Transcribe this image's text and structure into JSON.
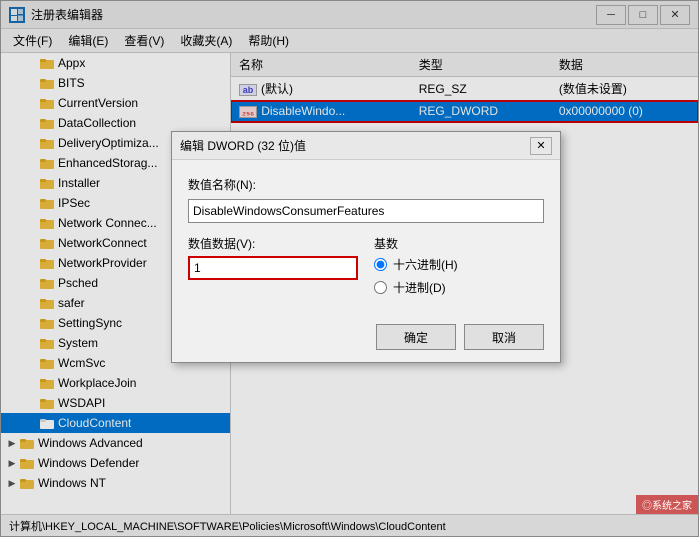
{
  "window": {
    "title": "注册表编辑器",
    "icon_text": "R"
  },
  "menu": {
    "items": [
      "文件(F)",
      "编辑(E)",
      "查看(V)",
      "收藏夹(A)",
      "帮助(H)"
    ]
  },
  "tree": {
    "items": [
      {
        "label": "Appx",
        "indent": 1,
        "expanded": false,
        "selected": false
      },
      {
        "label": "BITS",
        "indent": 1,
        "expanded": false,
        "selected": false
      },
      {
        "label": "CurrentVersion",
        "indent": 1,
        "expanded": false,
        "selected": false
      },
      {
        "label": "DataCollection",
        "indent": 1,
        "expanded": false,
        "selected": false
      },
      {
        "label": "DeliveryOptimiza...",
        "indent": 1,
        "expanded": false,
        "selected": false
      },
      {
        "label": "EnhancedStorag...",
        "indent": 1,
        "expanded": false,
        "selected": false
      },
      {
        "label": "Installer",
        "indent": 1,
        "expanded": false,
        "selected": false
      },
      {
        "label": "IPSec",
        "indent": 1,
        "expanded": false,
        "selected": false
      },
      {
        "label": "Network Connec...",
        "indent": 1,
        "expanded": false,
        "selected": false
      },
      {
        "label": "NetworkConnect",
        "indent": 1,
        "expanded": false,
        "selected": false
      },
      {
        "label": "NetworkProvider",
        "indent": 1,
        "expanded": false,
        "selected": false
      },
      {
        "label": "Psched",
        "indent": 1,
        "expanded": false,
        "selected": false
      },
      {
        "label": "safer",
        "indent": 1,
        "expanded": false,
        "selected": false
      },
      {
        "label": "SettingSync",
        "indent": 1,
        "expanded": false,
        "selected": false
      },
      {
        "label": "System",
        "indent": 1,
        "expanded": false,
        "selected": false
      },
      {
        "label": "WcmSvc",
        "indent": 1,
        "expanded": false,
        "selected": false
      },
      {
        "label": "WorkplaceJoin",
        "indent": 1,
        "expanded": false,
        "selected": false
      },
      {
        "label": "WSDAPI",
        "indent": 1,
        "expanded": false,
        "selected": false
      },
      {
        "label": "CloudContent",
        "indent": 1,
        "expanded": false,
        "selected": true
      },
      {
        "label": "Windows Advanced",
        "indent": 0,
        "expanded": false,
        "selected": false
      },
      {
        "label": "Windows Defender",
        "indent": 0,
        "expanded": false,
        "selected": false
      },
      {
        "label": "Windows NT",
        "indent": 0,
        "expanded": false,
        "selected": false
      }
    ]
  },
  "registry_table": {
    "columns": [
      "名称",
      "类型",
      "数据"
    ],
    "rows": [
      {
        "name": "(默认)",
        "type": "REG_SZ",
        "data": "(数值未设置)",
        "selected": false,
        "icon": "ab"
      },
      {
        "name": "DisableWindo...",
        "type": "REG_DWORD",
        "data": "0x00000000 (0)",
        "selected": true,
        "icon": "dword"
      }
    ]
  },
  "dialog": {
    "title": "编辑 DWORD (32 位)值",
    "name_label": "数值名称(N):",
    "name_value": "DisableWindowsConsumerFeatures",
    "value_label": "数值数据(V):",
    "value_input": "1",
    "radix_label": "基数",
    "radix_options": [
      {
        "label": "十六进制(H)",
        "value": "hex",
        "checked": true
      },
      {
        "label": "十进制(D)",
        "value": "dec",
        "checked": false
      }
    ],
    "ok_label": "确定",
    "cancel_label": "取消"
  },
  "status_bar": {
    "path": "计算机\\HKEY_LOCAL_MACHINE\\SOFTWARE\\Policies\\Microsoft\\Windows\\CloudContent"
  },
  "watermark": "◎系统之家"
}
